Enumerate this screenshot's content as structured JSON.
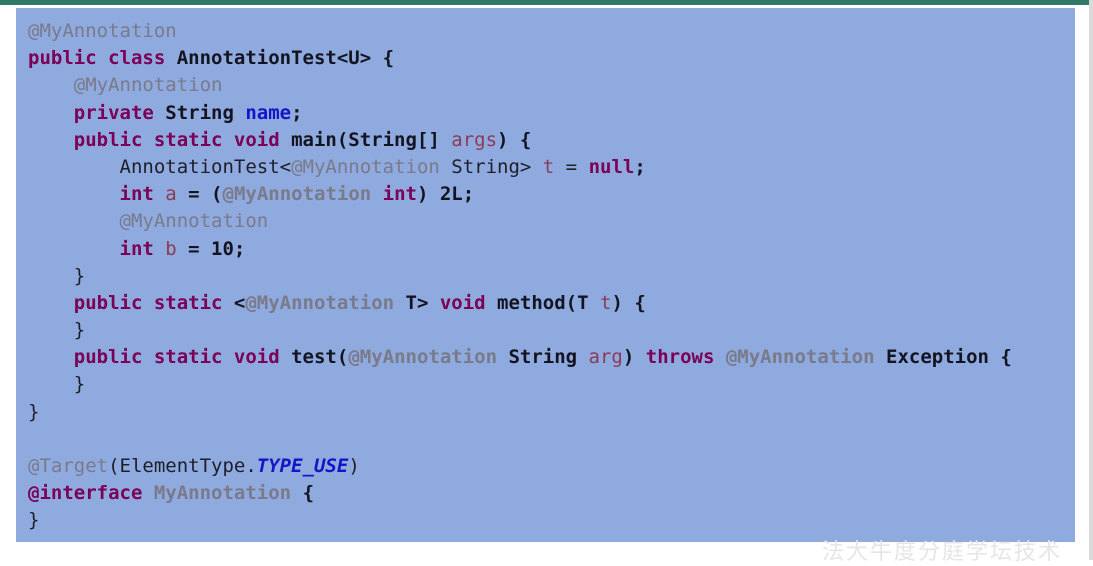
{
  "window": {
    "accent_color": "#2f7a66",
    "editor_background": "#8eaadf"
  },
  "code": {
    "lines": [
      [
        {
          "text": "@MyAnnotation",
          "style": "ann"
        }
      ],
      [
        {
          "text": "public class ",
          "style": "kw"
        },
        {
          "text": "AnnotationTest<U> {",
          "style": "bold"
        }
      ],
      [
        {
          "text": "    @MyAnnotation",
          "style": "ann"
        }
      ],
      [
        {
          "text": "    private ",
          "style": "kw"
        },
        {
          "text": "String ",
          "style": "bold"
        },
        {
          "text": "name",
          "style": "field"
        },
        {
          "text": ";",
          "style": "bold"
        }
      ],
      [
        {
          "text": "    public static void ",
          "style": "kw"
        },
        {
          "text": "main(String[] ",
          "style": "bold"
        },
        {
          "text": "args",
          "style": "var"
        },
        {
          "text": ") {",
          "style": "bold"
        }
      ],
      [
        {
          "text": "        AnnotationTest<",
          "style": "plain"
        },
        {
          "text": "@MyAnnotation",
          "style": "ann"
        },
        {
          "text": " String> ",
          "style": "plain"
        },
        {
          "text": "t",
          "style": "var"
        },
        {
          "text": " = ",
          "style": "plain"
        },
        {
          "text": "null",
          "style": "kw"
        },
        {
          "text": ";",
          "style": "bold"
        }
      ],
      [
        {
          "text": "        int ",
          "style": "kw"
        },
        {
          "text": "a",
          "style": "var"
        },
        {
          "text": " = (",
          "style": "bold"
        },
        {
          "text": "@MyAnnotation",
          "style": "ann-bold"
        },
        {
          "text": " int",
          "style": "kw"
        },
        {
          "text": ") 2L;",
          "style": "bold"
        }
      ],
      [
        {
          "text": "        @MyAnnotation",
          "style": "ann"
        }
      ],
      [
        {
          "text": "        int ",
          "style": "kw"
        },
        {
          "text": "b",
          "style": "var"
        },
        {
          "text": " = 10;",
          "style": "bold"
        }
      ],
      [
        {
          "text": "    }",
          "style": "plain"
        }
      ],
      [
        {
          "text": "    public static ",
          "style": "kw"
        },
        {
          "text": "<",
          "style": "bold"
        },
        {
          "text": "@MyAnnotation",
          "style": "ann-bold"
        },
        {
          "text": " T> ",
          "style": "bold"
        },
        {
          "text": "void ",
          "style": "kw"
        },
        {
          "text": "method(T ",
          "style": "bold"
        },
        {
          "text": "t",
          "style": "var"
        },
        {
          "text": ") {",
          "style": "bold"
        }
      ],
      [
        {
          "text": "    }",
          "style": "plain"
        }
      ],
      [
        {
          "text": "    public static void ",
          "style": "kw"
        },
        {
          "text": "test(",
          "style": "bold"
        },
        {
          "text": "@MyAnnotation",
          "style": "ann-bold"
        },
        {
          "text": " String ",
          "style": "bold"
        },
        {
          "text": "arg",
          "style": "var"
        },
        {
          "text": ") ",
          "style": "bold"
        },
        {
          "text": "throws ",
          "style": "kw"
        },
        {
          "text": "@MyAnnotation",
          "style": "ann-bold"
        },
        {
          "text": " Exception {",
          "style": "bold"
        }
      ],
      [
        {
          "text": "    }",
          "style": "plain"
        }
      ],
      [
        {
          "text": "}",
          "style": "plain"
        }
      ],
      [],
      [
        {
          "text": "@Target",
          "style": "ann"
        },
        {
          "text": "(ElementType.",
          "style": "plain"
        },
        {
          "text": "TYPE_USE",
          "style": "const"
        },
        {
          "text": ")",
          "style": "plain"
        }
      ],
      [
        {
          "text": "@interface ",
          "style": "kw"
        },
        {
          "text": "MyAnnotation",
          "style": "ann-bold"
        },
        {
          "text": " {",
          "style": "bold"
        }
      ],
      [
        {
          "text": "}",
          "style": "plain"
        }
      ]
    ]
  },
  "watermark": {
    "text": "法大牛度分庭学坛技术"
  }
}
